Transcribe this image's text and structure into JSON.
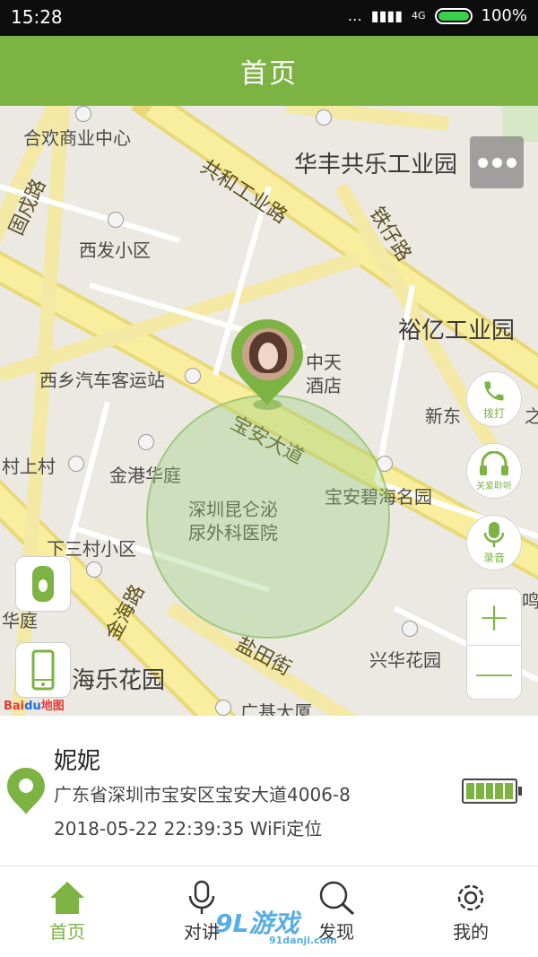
{
  "status_bar": {
    "time": "15:28",
    "indicators": "…",
    "network": "4G",
    "battery_percent": "100%",
    "battery_level": 1.0
  },
  "header": {
    "title": "首页"
  },
  "map": {
    "labels": {
      "l1": "合欢商业中心",
      "l2": "华丰共乐工业园",
      "l3": "共和工业路",
      "l4": "铁仔路",
      "l5": "西发小区",
      "l6": "裕亿工业园",
      "l7": "西乡汽车客运站",
      "l8": "中天",
      "l9": "酒店",
      "l10": "新东",
      "l11": "宝安大道",
      "l12": "村上村",
      "l13": "金港华庭",
      "l14": "宝安碧海名园",
      "l15": "深圳昆仑泌",
      "l16": "尿外科医院",
      "l17": "下三村小区",
      "l18": "华庭",
      "l19": "金海路",
      "l20": "盐田街",
      "l21": "兴华花园",
      "l22": "海乐花园",
      "l23": "广基大厦",
      "l24": "鸣",
      "l25": "固戍路",
      "l26": "之"
    },
    "attribution_brand": "Bai",
    "attribution_du": "du",
    "attribution_text": "地图"
  },
  "actions": {
    "call_label": "拨打",
    "listen_label": "关爱聆听",
    "record_label": "录音",
    "zoom_in": "+",
    "zoom_out": "—"
  },
  "device": {
    "name": "妮妮",
    "address": "广东省深圳市宝安区宝安大道4006-8",
    "timestamp": "2018-05-22 22:39:35 WiFi定位",
    "battery_level": 1.0
  },
  "bottom_nav": [
    {
      "label": "首页",
      "icon": "home-icon",
      "active": true
    },
    {
      "label": "对讲",
      "icon": "microphone-icon",
      "active": false
    },
    {
      "label": "发现",
      "icon": "search-icon",
      "active": false
    },
    {
      "label": "我的",
      "icon": "gear-icon",
      "active": false
    }
  ],
  "watermark": {
    "text": "9L游戏",
    "sub": "91danji.com"
  },
  "colors": {
    "accent": "#7cb342",
    "statusbar": "#0d0d0d",
    "road": "#f6ea8c"
  }
}
